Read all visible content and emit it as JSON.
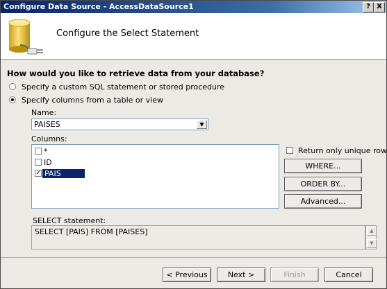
{
  "window": {
    "title": "Configure Data Source - AccessDataSource1",
    "help_label": "?",
    "close_label": "X"
  },
  "header": {
    "title": "Configure the Select Statement",
    "icon": "database-plug-icon"
  },
  "question": "How would you like to retrieve data from your database?",
  "options": [
    {
      "label": "Specify a custom SQL statement or stored procedure",
      "selected": false
    },
    {
      "label": "Specify columns from a table or view",
      "selected": true
    }
  ],
  "name_label": "Name:",
  "name_value": "PAISES",
  "columns_label": "Columns:",
  "columns": [
    {
      "label": "*",
      "checked": false
    },
    {
      "label": "ID",
      "checked": false
    },
    {
      "label": "PAIS",
      "checked": true
    }
  ],
  "unique_rows_label": "Return only unique rows",
  "buttons": {
    "where": "WHERE...",
    "order_by": "ORDER BY...",
    "advanced": "Advanced..."
  },
  "select_statement_label": "SELECT statement:",
  "select_statement": "SELECT [PAIS] FROM [PAISES]",
  "nav": {
    "previous": "< Previous",
    "next": "Next >",
    "finish": "Finish",
    "cancel": "Cancel"
  },
  "colors": {
    "titlebar": "#0a246a",
    "selection": "#0a246a",
    "window_bg": "#eceae4"
  }
}
